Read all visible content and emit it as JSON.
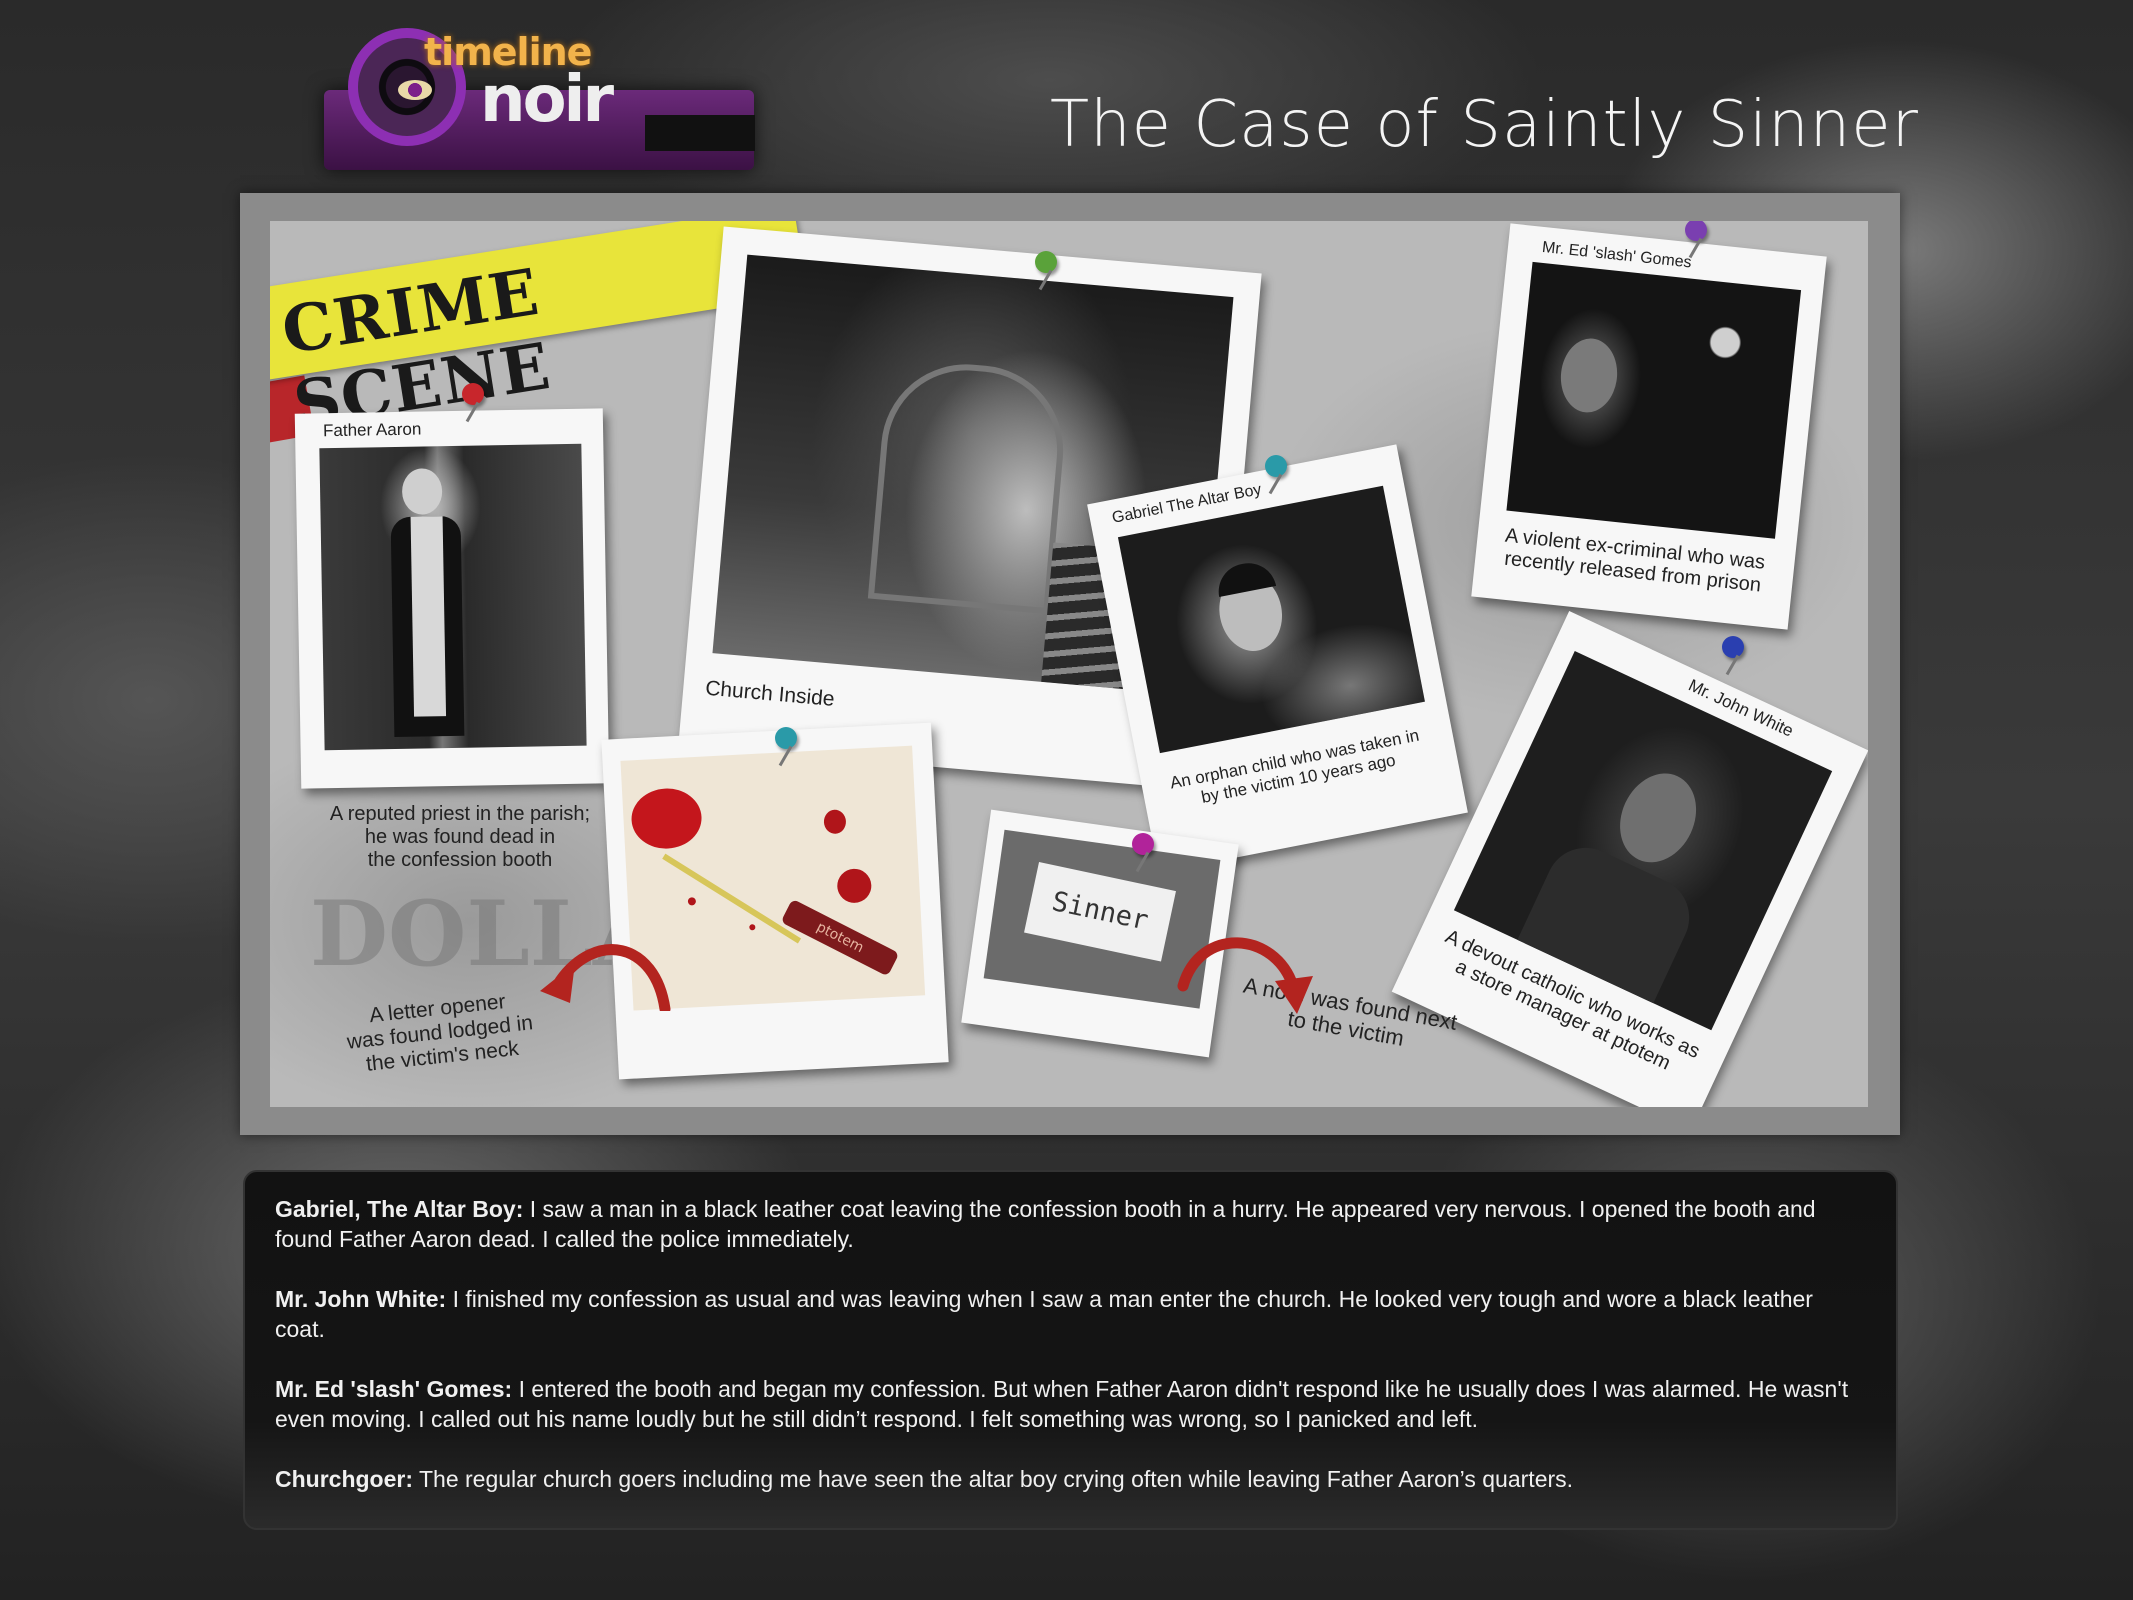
{
  "logo": {
    "word1": "timeline",
    "word2": "noir"
  },
  "title": "The Case of Saintly Sinner",
  "board": {
    "tape_label": "CRIME SCENE",
    "photos": {
      "father_aaron": {
        "label": "Father Aaron",
        "note": [
          "A reputed priest in the parish;",
          "he was found dead in",
          "the confession booth"
        ]
      },
      "church": {
        "label": "Church Inside"
      },
      "gabriel": {
        "label": "Gabriel The Altar Boy",
        "note": [
          "An orphan child who was taken in",
          "by the victim 10 years ago"
        ]
      },
      "ed_gomes": {
        "label": "Mr. Ed 'slash' Gomes",
        "note": [
          "A violent ex-criminal who was",
          "recently released from prison"
        ]
      },
      "john_white": {
        "label": "Mr. John White",
        "note": [
          "A devout catholic who works as",
          "a store manager at ptotem"
        ]
      },
      "letter_opener": {
        "brand": "ptotem",
        "note": [
          "A letter opener",
          "was found lodged in",
          "the victim's neck"
        ]
      },
      "note_card": {
        "word": "Sinner",
        "note": [
          "A note was found next",
          "to the victim"
        ]
      }
    },
    "background_words": [
      "DOLLA"
    ],
    "colors": {
      "tape": "#e8e43a",
      "arrow": "#b3241f",
      "logo_purple": "#8d2fb3",
      "logo_orange": "#f2b34b"
    }
  },
  "testimonies": [
    {
      "speaker": "Gabriel, The Altar Boy:",
      "text": " I saw a man in a black leather coat leaving the confession booth in a hurry. He appeared very nervous. I opened the booth and found Father Aaron dead. I called the police immediately."
    },
    {
      "speaker": "Mr. John White:",
      "text": " I finished my confession as usual and was leaving when I saw a man enter the church. He looked very tough and wore a black leather coat."
    },
    {
      "speaker": "Mr. Ed 'slash' Gomes:",
      "text": " I entered the booth and began my confession. But when Father Aaron didn't respond like he usually does I was alarmed. He wasn't even moving. I called out his name loudly but he still didn’t respond. I felt something was wrong, so I panicked and left."
    },
    {
      "speaker": "Churchgoer:",
      "text": " The regular church goers including me have seen the altar boy crying often while leaving Father Aaron’s quarters."
    }
  ]
}
